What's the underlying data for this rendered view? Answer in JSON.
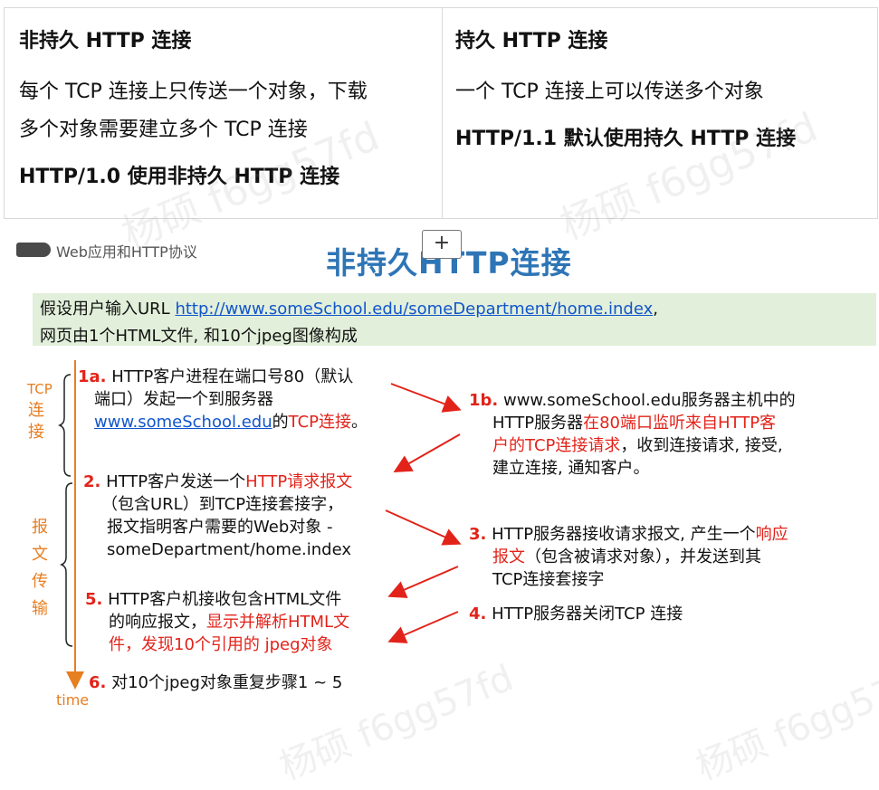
{
  "table": {
    "left": {
      "heading": "非持久 HTTP 连接",
      "line1": "每个 TCP 连接上只传送一个对象，下载",
      "line2": "多个对象需要建立多个 TCP 连接",
      "note": "HTTP/1.0 使用非持久 HTTP 连接"
    },
    "right": {
      "heading": "持久 HTTP 连接",
      "line1": "一个 TCP 连接上可以传送多个对象",
      "note": "HTTP/1.1 默认使用持久 HTTP 连接"
    },
    "watermark": "杨硕 f6gg57fd"
  },
  "insert_button": "+",
  "slide": {
    "breadcrumb": "Web应用和HTTP协议",
    "title": "非持久HTTP连接",
    "assume_prefix": "假设用户输入URL ",
    "url": "http://www.someSchool.edu/someDepartment/home.index",
    "assume_suffix": ",",
    "assume_line2": "网页由1个HTML文件, 和10个jpeg图像构成",
    "side_tcp": [
      "TCP",
      "连",
      "接"
    ],
    "side_msg": [
      "报",
      "文",
      "传",
      "输"
    ],
    "time_label": "time",
    "steps": {
      "s1a_num": "1a.",
      "s1a_l1": " HTTP客户进程在端口号80（默认",
      "s1a_l2": "端口）发起一个到服务器",
      "s1a_link": "www.someSchool.edu",
      "s1a_mid": "的",
      "s1a_red": "TCP连接",
      "s1a_end": "。",
      "s1b_num": "1b.",
      "s1b_l1": " www.someSchool.edu服务器主机中的",
      "s1b_l2a": "HTTP服务器",
      "s1b_l2red": "在80端口监听来自HTTP客",
      "s1b_l3red": "户的TCP连接请求",
      "s1b_l3b": "，收到连接请求, 接受,",
      "s1b_l4": "建立连接, 通知客户。",
      "s2_num": "2.",
      "s2_l1a": " HTTP客户发送一个",
      "s2_l1red": "HTTP请求报文",
      "s2_l2": "（包含URL）到TCP连接套接字，",
      "s2_l3": "报文指明客户需要的Web对象 -",
      "s2_l4": "someDepartment/home.index",
      "s3_num": "3.",
      "s3_l1a": " HTTP服务器接收请求报文, 产生一个",
      "s3_l1red": "响应",
      "s3_l2red": "报文",
      "s3_l2b": "（包含被请求对象），并发送到其",
      "s3_l3": "TCP连接套接字",
      "s4_num": "4.",
      "s4_l1": " HTTP服务器关闭TCP 连接",
      "s5_num": "5.",
      "s5_l1": " HTTP客户机接收包含HTML文件",
      "s5_l2a": "的响应报文，",
      "s5_l2red": "显示并解析HTML文",
      "s5_l3red": "件，发现10个引用的 jpeg对象",
      "s6_num": "6.",
      "s6_l1": " 对10个jpeg对象重复步骤1 ~ 5"
    }
  },
  "colors": {
    "title": "#2e75b6",
    "accent_red": "#e2231a",
    "timeline": "#e67e22",
    "banner": "#e2efda"
  }
}
